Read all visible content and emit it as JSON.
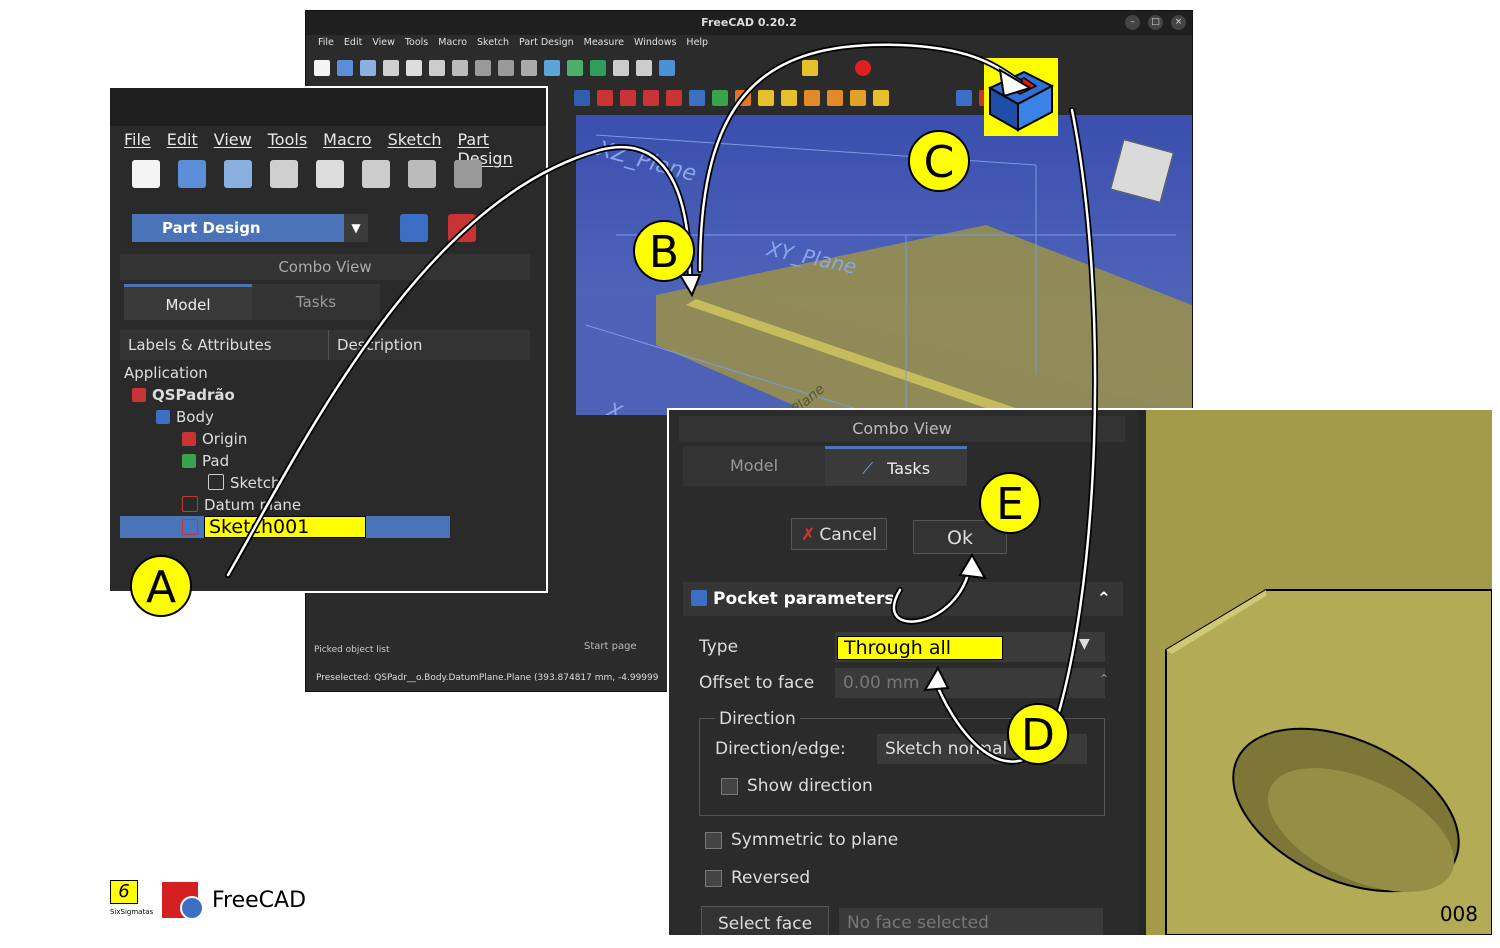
{
  "main_window": {
    "title": "FreeCAD 0.20.2",
    "menu": [
      "File",
      "Edit",
      "View",
      "Tools",
      "Macro",
      "Sketch",
      "Part Design",
      "Measure",
      "Windows",
      "Help"
    ],
    "viewport_labels": {
      "xz_plane": "XZ_Plane",
      "xy_plane": "XY_Plane",
      "plane": "Plane",
      "x": "X"
    },
    "picked_list": "Picked object list",
    "start_page": "Start page",
    "status": "Preselected: QSPadr__o.Body.DatumPlane.Plane (393.874817 mm, -4.99999"
  },
  "left_zoom": {
    "menu": [
      "File",
      "Edit",
      "View",
      "Tools",
      "Macro",
      "Sketch",
      "Part Design"
    ],
    "workbench": "Part Design",
    "combo_title": "Combo View",
    "tabs": [
      "Model",
      "Tasks"
    ],
    "columns": [
      "Labels & Attributes",
      "Description"
    ],
    "tree": {
      "application": "Application",
      "document": "QSPadrão",
      "body": "Body",
      "origin": "Origin",
      "pad": "Pad",
      "sketch": "Sketch",
      "datum_plane": "Datum plane",
      "sketch001": "Sketch001"
    }
  },
  "right_zoom": {
    "combo_title": "Combo View",
    "tabs": [
      "Model",
      "Tasks"
    ],
    "cancel": "Cancel",
    "ok": "Ok",
    "section_title": "Pocket parameters",
    "type_label": "Type",
    "type_value": "Through all",
    "offset_label": "Offset to face",
    "offset_value": "0.00 mm",
    "direction_group": "Direction",
    "direction_label": "Direction/edge:",
    "direction_value": "Sketch normal",
    "show_direction": "Show direction",
    "symmetric": "Symmetric to plane",
    "reversed": "Reversed",
    "select_face": "Select face",
    "no_face": "No face selected"
  },
  "callouts": {
    "a": "A",
    "b": "B",
    "c": "C",
    "d": "D",
    "e": "E"
  },
  "logo": {
    "name": "FreeCAD",
    "brand": "SixSigmatas"
  },
  "page_number": "008",
  "colors": {
    "highlight": "#ffff00",
    "selection": "#4a73b8",
    "viewport": "#4a5fb5",
    "model": "#a39a4a"
  }
}
